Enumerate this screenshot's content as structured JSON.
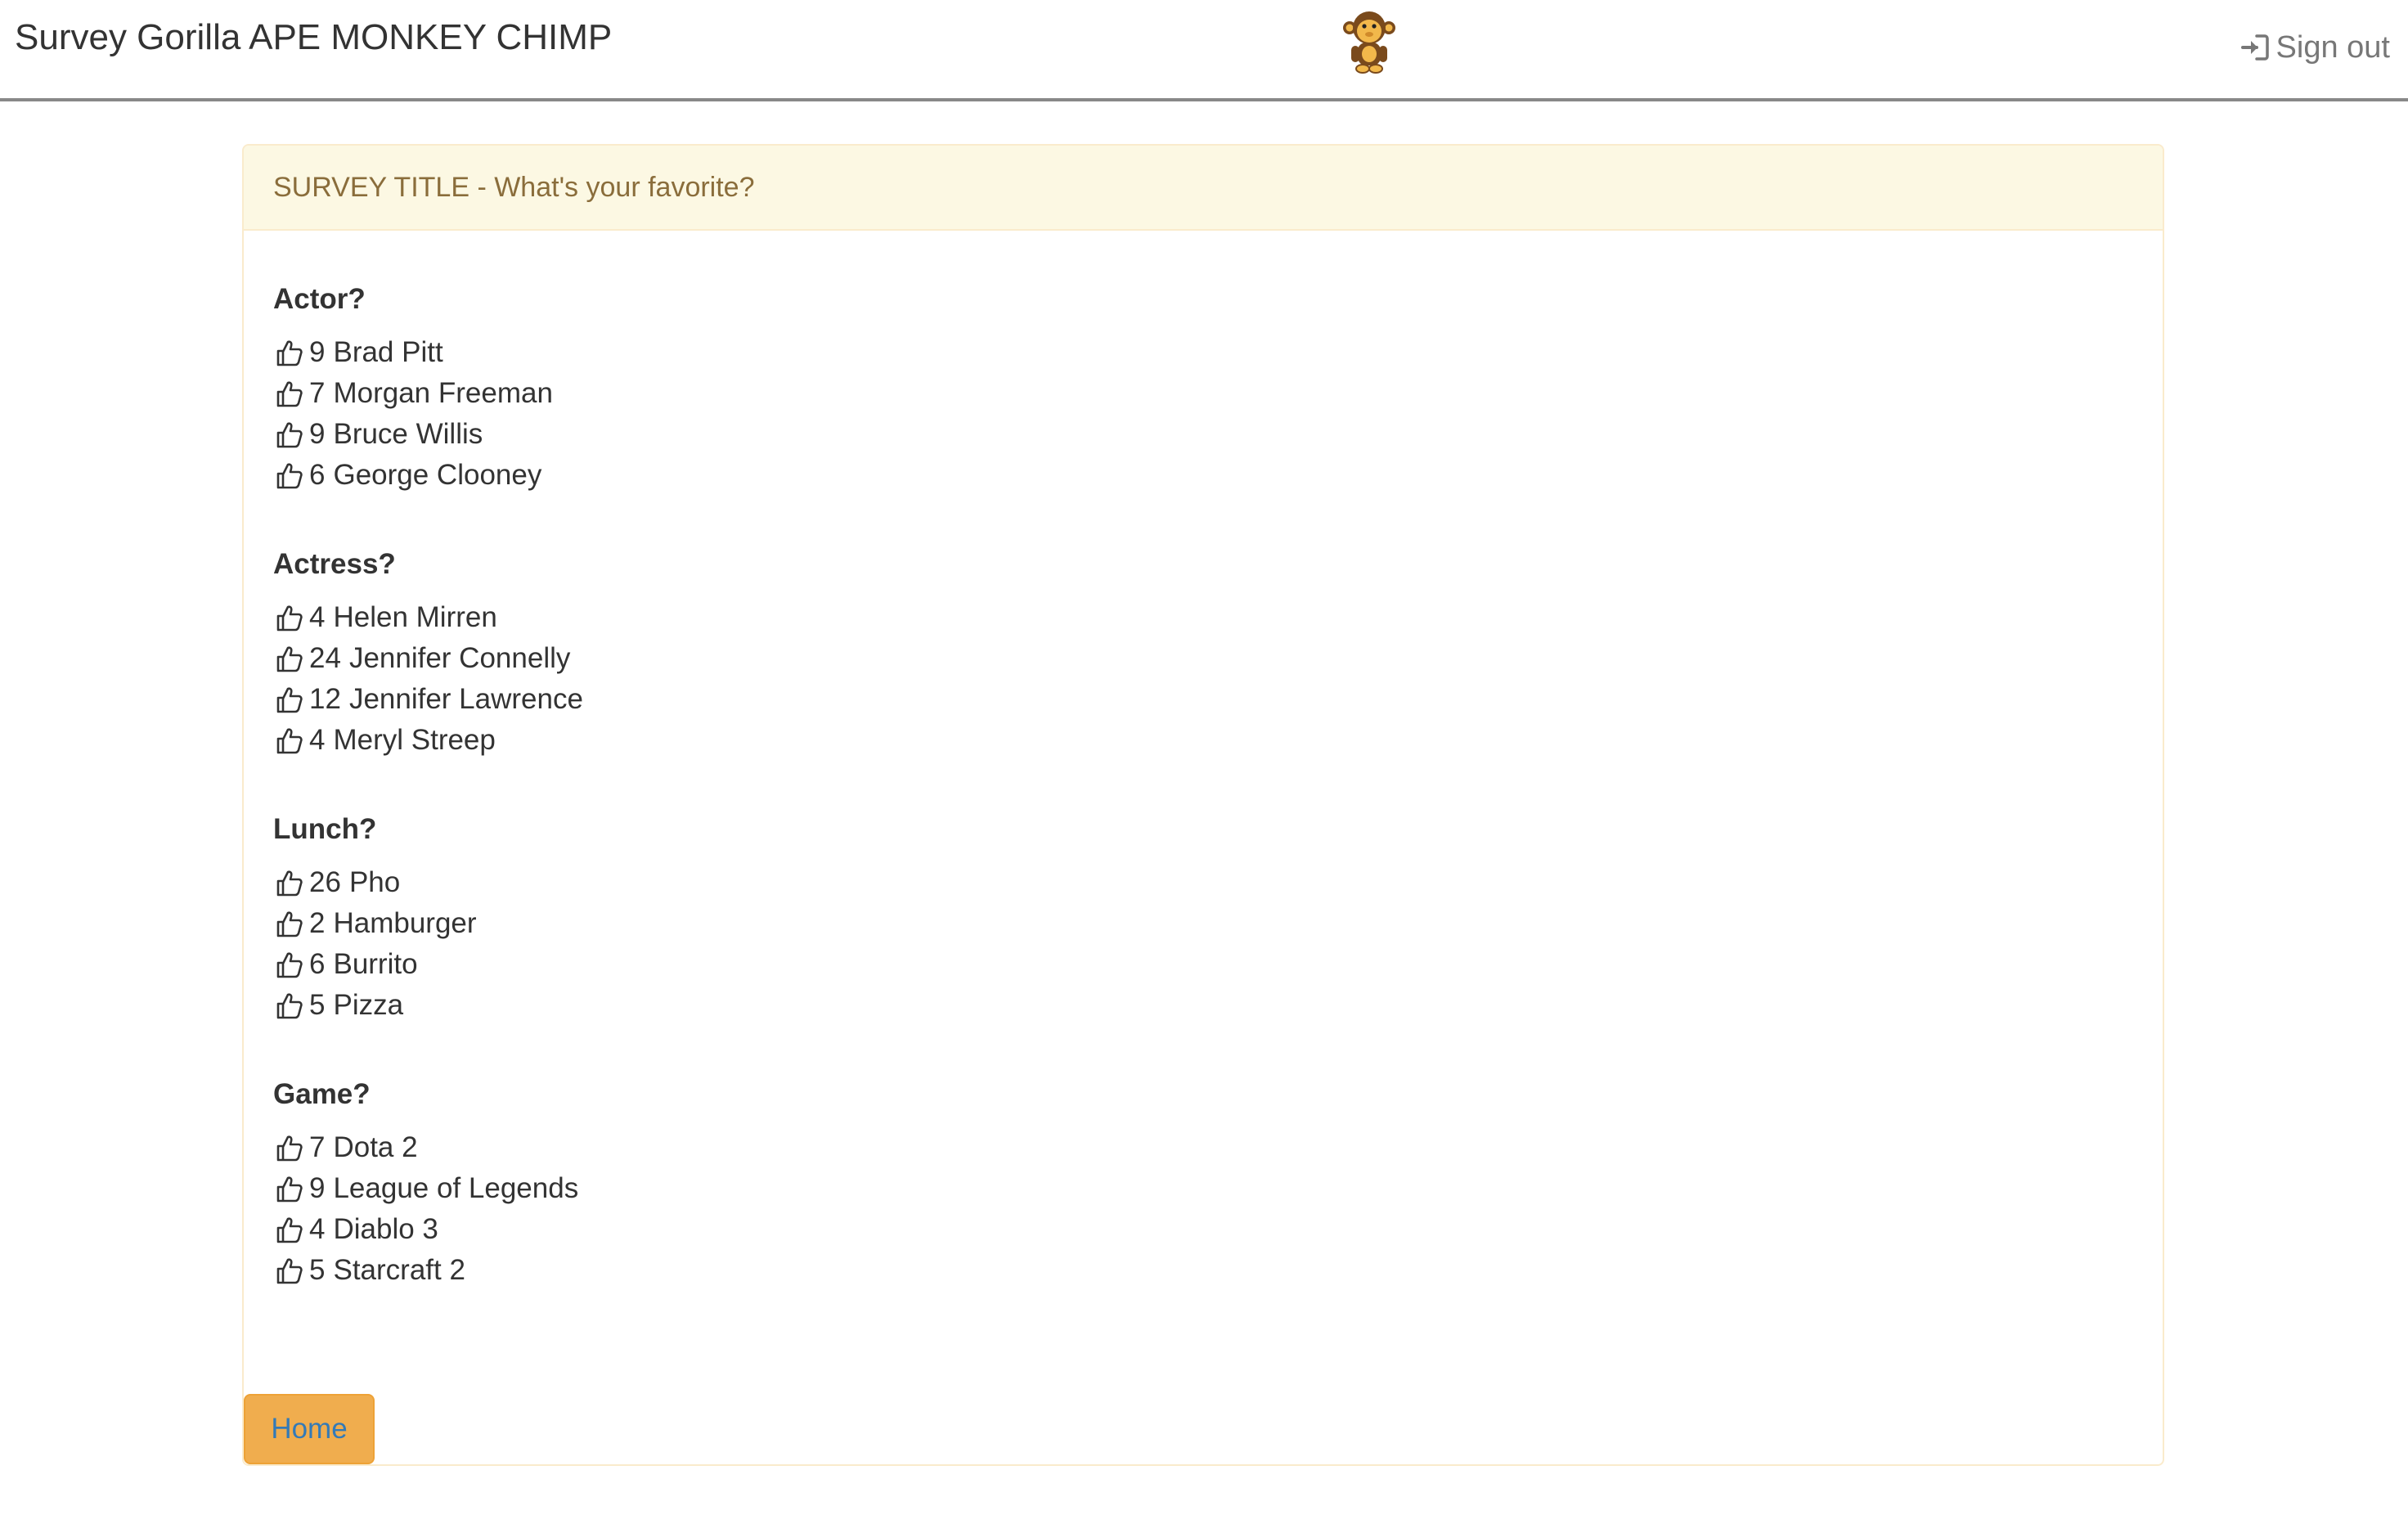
{
  "header": {
    "title": "Survey Gorilla APE MONKEY CHIMP",
    "logo_icon": "monkey-mascot-icon",
    "sign_out_label": "Sign out",
    "sign_out_icon": "sign-in-arrow-icon"
  },
  "survey": {
    "title": "SURVEY TITLE - What's your favorite?",
    "questions": [
      {
        "title": "Actor?",
        "answers": [
          {
            "count": "9",
            "label": "Brad Pitt"
          },
          {
            "count": "7",
            "label": "Morgan Freeman"
          },
          {
            "count": "9",
            "label": "Bruce Willis"
          },
          {
            "count": "6",
            "label": "George Clooney"
          }
        ]
      },
      {
        "title": "Actress?",
        "answers": [
          {
            "count": "4",
            "label": "Helen Mirren"
          },
          {
            "count": "24",
            "label": "Jennifer Connelly"
          },
          {
            "count": "12",
            "label": "Jennifer Lawrence"
          },
          {
            "count": "4",
            "label": "Meryl Streep"
          }
        ]
      },
      {
        "title": "Lunch?",
        "answers": [
          {
            "count": "26",
            "label": "Pho"
          },
          {
            "count": "2",
            "label": "Hamburger"
          },
          {
            "count": "6",
            "label": "Burrito"
          },
          {
            "count": "5",
            "label": "Pizza"
          }
        ]
      },
      {
        "title": "Game?",
        "answers": [
          {
            "count": "7",
            "label": "Dota 2"
          },
          {
            "count": "9",
            "label": "League of Legends"
          },
          {
            "count": "4",
            "label": "Diablo 3"
          },
          {
            "count": "5",
            "label": "Starcraft 2"
          }
        ]
      }
    ],
    "vote_icon": "thumbs-up-icon",
    "home_label": "Home"
  },
  "colors": {
    "panel_heading_bg": "#fcf8e3",
    "panel_heading_text": "#8a6d3b",
    "panel_border": "#faebcc",
    "home_button_bg": "#f0ad4e",
    "home_button_text": "#337ab7",
    "sign_out_text": "#777777"
  }
}
